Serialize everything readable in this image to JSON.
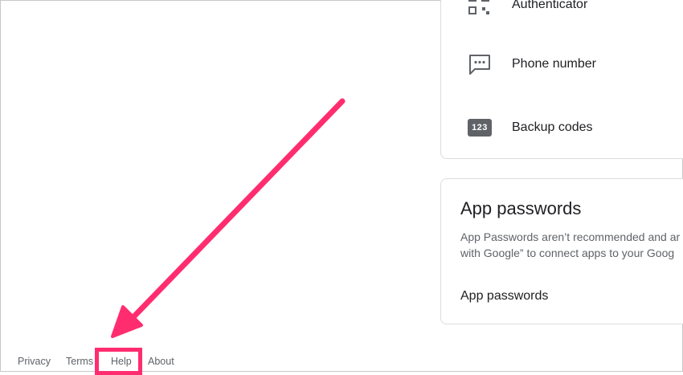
{
  "signin_methods": {
    "items": [
      {
        "label": "Authenticator",
        "icon": "authenticator-icon"
      },
      {
        "label": "Phone number",
        "icon": "phone-message-icon"
      },
      {
        "label": "Backup codes",
        "icon": "backup-codes-icon",
        "badge": "123"
      }
    ]
  },
  "app_passwords_card": {
    "title": "App passwords",
    "description_line1": "App Passwords aren’t recommended and ar",
    "description_line2": "with Google” to connect apps to your Goog",
    "link_label": "App passwords"
  },
  "footer": {
    "links": [
      "Privacy",
      "Terms",
      "Help",
      "About"
    ]
  },
  "annotation": {
    "color": "#ff2d6f",
    "highlighted_link": "Help"
  }
}
